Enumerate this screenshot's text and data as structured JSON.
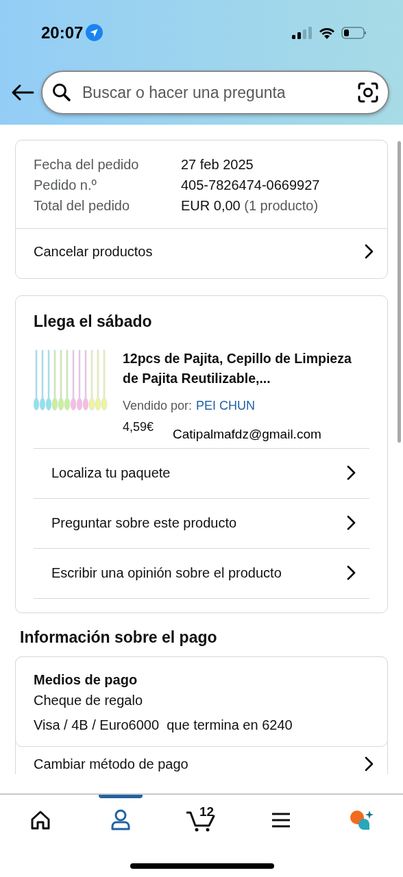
{
  "status_bar": {
    "time": "20:07"
  },
  "search": {
    "placeholder": "Buscar o hacer una pregunta"
  },
  "order_summary": {
    "rows": [
      {
        "label": "Fecha del pedido",
        "value": "27 feb 2025"
      },
      {
        "label": "Pedido n.º",
        "value": "405-7826474-0669927"
      },
      {
        "label": "Total del pedido",
        "value": "EUR 0,00",
        "note": "(1 producto)"
      }
    ],
    "action": "Cancelar productos"
  },
  "shipment": {
    "title": "Llega el sábado",
    "product": {
      "name": "12pcs de Pajita, Cepillo de Limpieza de Pajita Reutilizable,...",
      "seller_label": "Vendido por:",
      "seller": "PEI CHUN",
      "price": "4,59€"
    },
    "overlay_text": "Catipalmafdz@gmail.com",
    "actions": [
      "Localiza tu paquete",
      "Preguntar sobre este producto",
      "Escribir una opinión sobre el producto"
    ]
  },
  "payment": {
    "heading": "Información sobre el pago",
    "methods_title": "Medios de pago",
    "methods": [
      "Cheque de regalo",
      "Visa / 4B / Euro6000  que termina en 6240"
    ],
    "action": "Cambiar método de pago"
  },
  "bottom_nav": [
    {
      "kind": "home",
      "selected": false
    },
    {
      "kind": "account",
      "selected": true
    },
    {
      "kind": "cart",
      "count": "12",
      "selected": false
    },
    {
      "kind": "menu",
      "selected": false
    },
    {
      "kind": "assistant",
      "selected": false
    }
  ]
}
